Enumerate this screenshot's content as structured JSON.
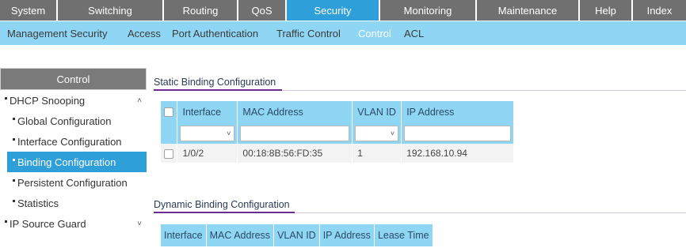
{
  "topnav": {
    "tabs": [
      {
        "label": "System"
      },
      {
        "label": "Switching"
      },
      {
        "label": "Routing"
      },
      {
        "label": "QoS"
      },
      {
        "label": "Security"
      },
      {
        "label": "Monitoring"
      },
      {
        "label": "Maintenance"
      },
      {
        "label": "Help"
      },
      {
        "label": "Index"
      }
    ],
    "active": "Security"
  },
  "subnav": {
    "items": [
      {
        "label": "Management Security"
      },
      {
        "label": "Access"
      },
      {
        "label": "Port Authentication"
      },
      {
        "label": "Traffic Control"
      },
      {
        "label": "Control"
      },
      {
        "label": "ACL"
      }
    ],
    "active": "Control"
  },
  "sidebar": {
    "header": "Control",
    "items": [
      {
        "label": "DHCP Snooping"
      },
      {
        "label": "Global Configuration"
      },
      {
        "label": "Interface Configuration"
      },
      {
        "label": "Binding Configuration"
      },
      {
        "label": "Persistent Configuration"
      },
      {
        "label": "Statistics"
      },
      {
        "label": "IP Source Guard"
      }
    ]
  },
  "static_binding": {
    "title": "Static Binding Configuration",
    "columns": [
      "Interface",
      "MAC Address",
      "VLAN ID",
      "IP Address"
    ],
    "filter": {
      "interface_value": "",
      "mac_value": "",
      "vlan_value": "",
      "ip_value": ""
    },
    "rows": [
      {
        "interface": "1/0/2",
        "mac": "00:18:8B:56:FD:35",
        "vlan": "1",
        "ip": "192.168.10.94"
      }
    ]
  },
  "dynamic_binding": {
    "title": "Dynamic Binding Configuration",
    "columns": [
      "Interface",
      "MAC Address",
      "VLAN ID",
      "IP Address",
      "Lease Time"
    ]
  },
  "colors": {
    "nav_gray": "#707070",
    "accent_blue": "#2e9fd8",
    "light_blue": "#8fd6f5",
    "purple": "#6a2c91"
  }
}
